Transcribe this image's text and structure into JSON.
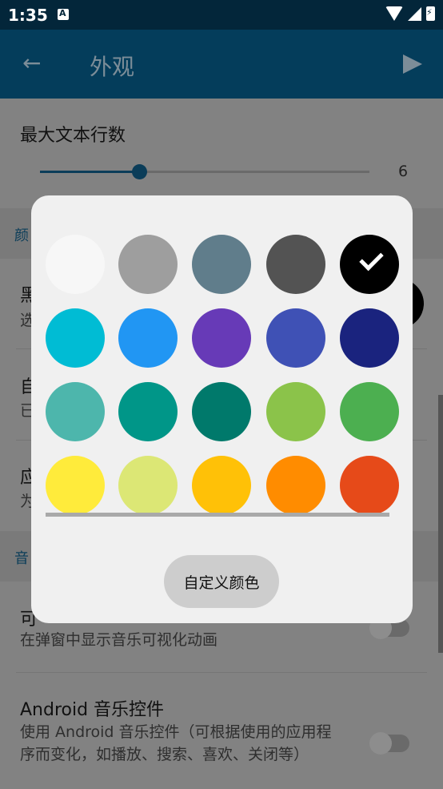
{
  "status_bar": {
    "time": "1:35"
  },
  "app_bar": {
    "title": "外观"
  },
  "prefs": {
    "max_lines_title": "最大文本行数",
    "max_lines_value": "6",
    "max_lines_slider_fraction": 0.3,
    "section_color_label_partial": "颜",
    "row1_title_partial": "黑",
    "row1_summary_partial": "选",
    "row2_title_partial": "自",
    "row2_summary_partial": "已",
    "row3_title_partial": "应",
    "row3_summary_partial": "为",
    "section_music_label_partial": "音",
    "visualizer_title_partial": "可",
    "visualizer_summary": "在弹窗中显示音乐可视化动画",
    "android_controls_title": "Android 音乐控件",
    "android_controls_summary": "使用 Android 音乐控件（可根据使用的应用程序而变化，如播放、搜索、喜欢、关闭等）"
  },
  "dialog": {
    "swatches": [
      [
        "#f7f7f7",
        "#9e9e9e",
        "#607d8b",
        "#535353",
        "#000000"
      ],
      [
        "#00bcd4",
        "#2196f3",
        "#673ab7",
        "#3f51b5",
        "#1a237e"
      ],
      [
        "#4db6ac",
        "#009688",
        "#00796b",
        "#8bc34a",
        "#4caf50"
      ],
      [
        "#ffeb3b",
        "#dce775",
        "#ffc107",
        "#ff8c00",
        "#e64a19"
      ]
    ],
    "selected": "#000000",
    "custom_color_button": "自定义颜色"
  }
}
